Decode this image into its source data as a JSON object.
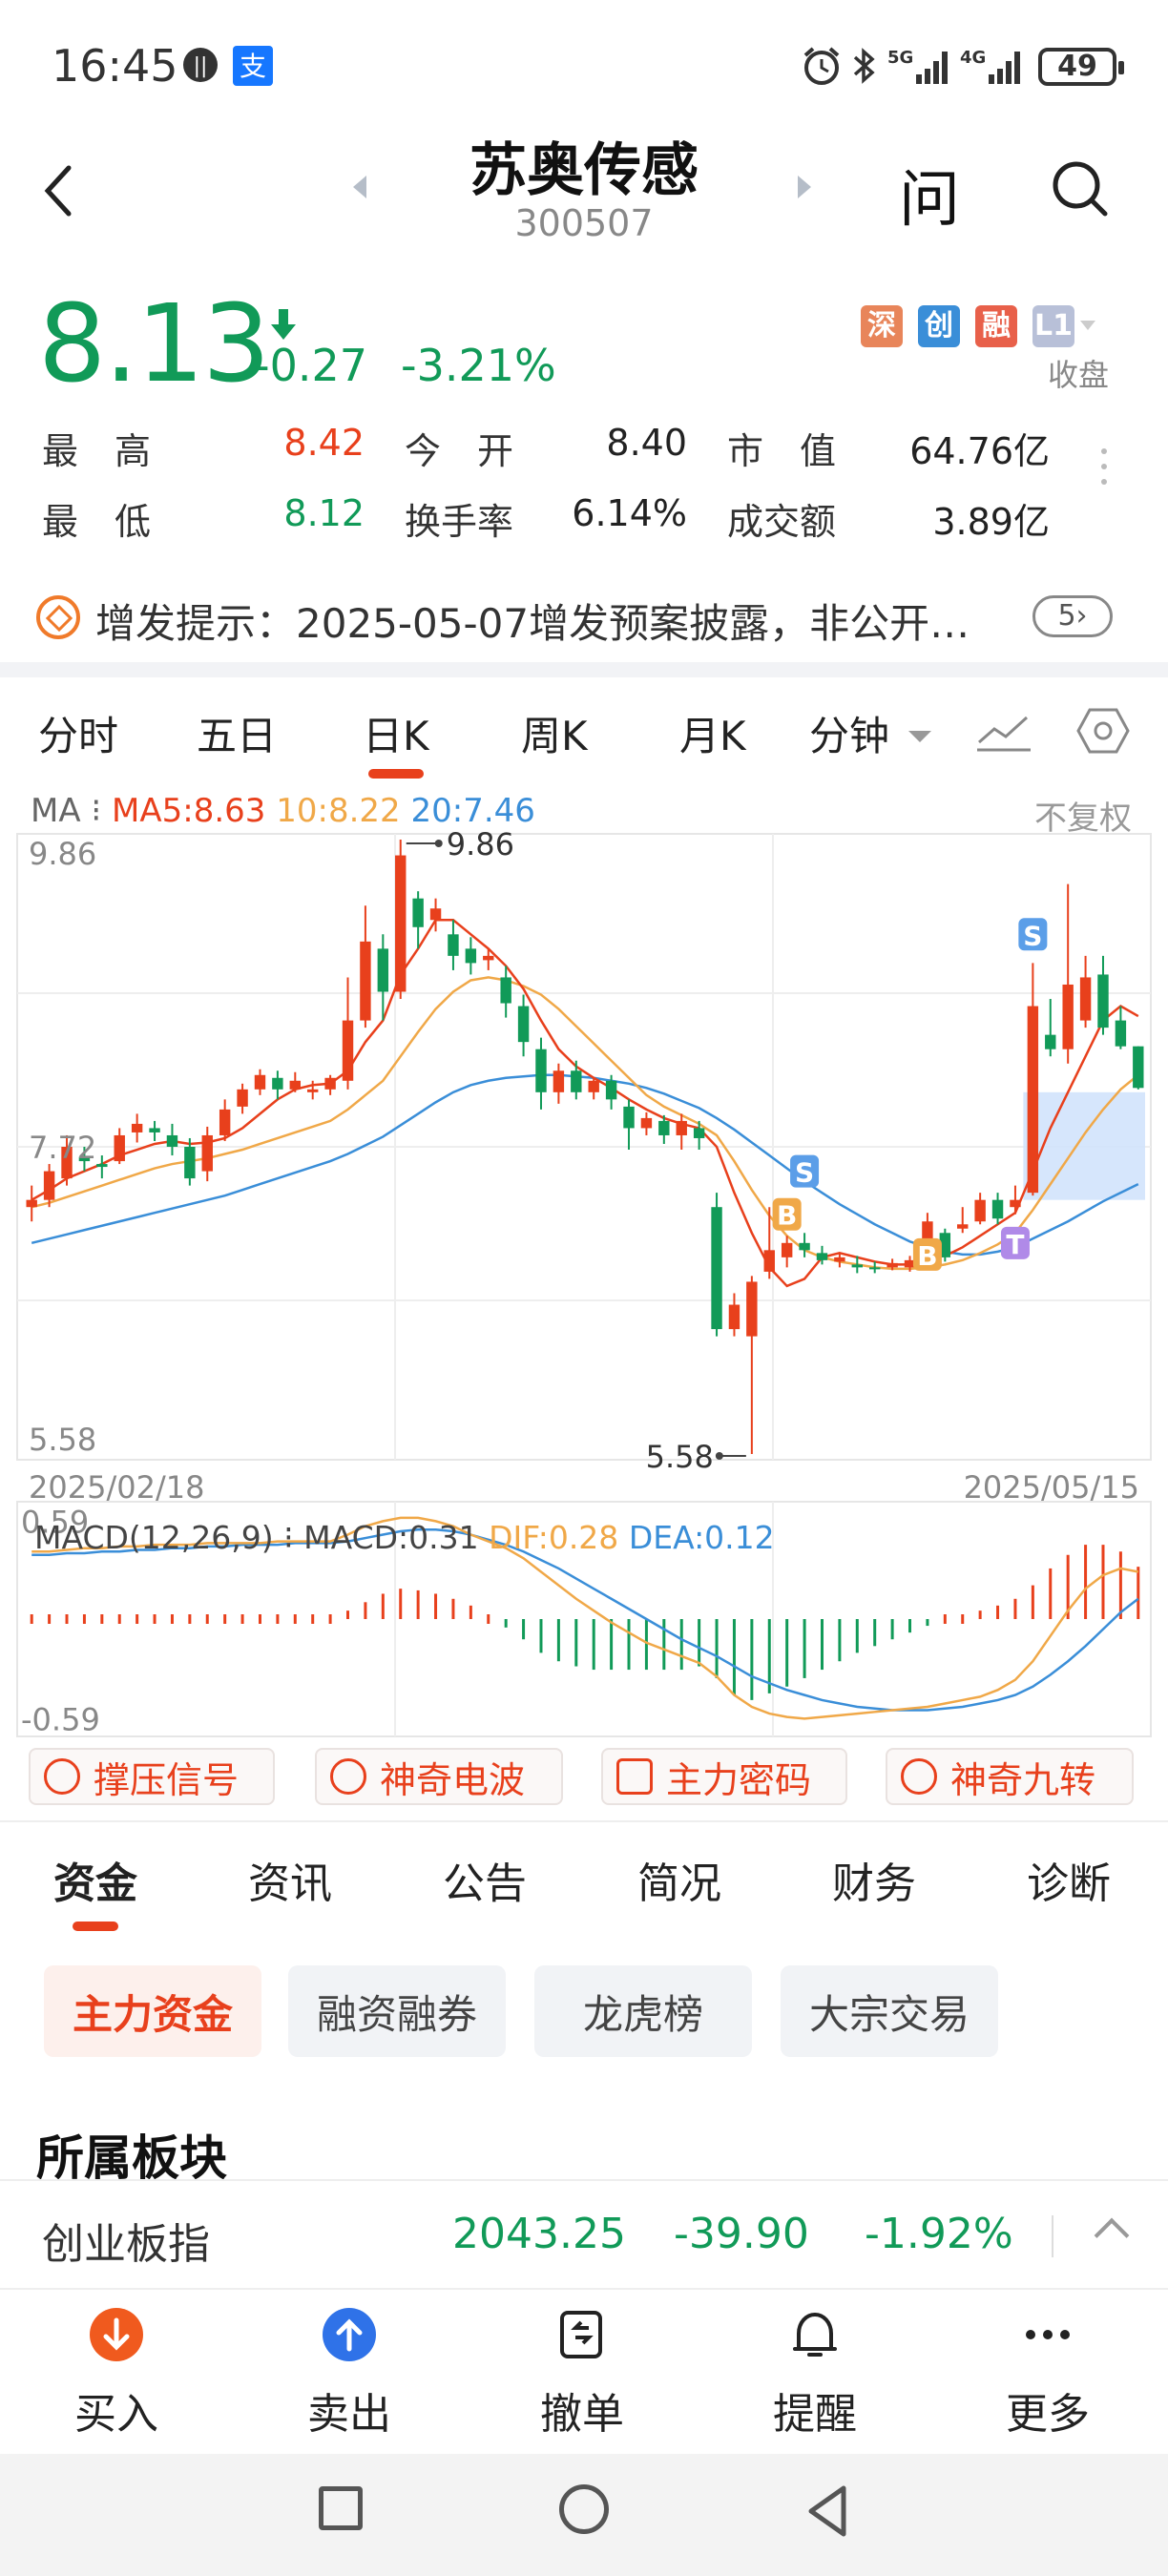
{
  "status_bar": {
    "time": "16:45",
    "battery": "49",
    "network_1": "5G",
    "network_2": "4G"
  },
  "header": {
    "stock_name": "苏奥传感",
    "stock_code": "300507",
    "ask_label": "问"
  },
  "quote": {
    "price": "8.13",
    "change": "-0.27",
    "change_pct": "-3.21%",
    "badges": [
      "深",
      "创",
      "融",
      "L1"
    ],
    "market_status": "收盘",
    "rows": [
      [
        {
          "label": "最　高",
          "value": "8.42",
          "tone": "red"
        },
        {
          "label": "今　开",
          "value": "8.40",
          "tone": "neutral"
        },
        {
          "label": "市　值",
          "value": "64.76亿",
          "tone": "neutral"
        }
      ],
      [
        {
          "label": "最　低",
          "value": "8.12",
          "tone": "green"
        },
        {
          "label": "换手率",
          "value": "6.14%",
          "tone": "neutral"
        },
        {
          "label": "成交额",
          "value": "3.89亿",
          "tone": "neutral"
        }
      ]
    ]
  },
  "notice": {
    "text": "增发提示：2025-05-07增发预案披露，非公开…",
    "count": "5"
  },
  "chart_tabs": [
    "分时",
    "五日",
    "日K",
    "周K",
    "月K",
    "分钟"
  ],
  "active_chart_tab": "日K",
  "ma": {
    "prefix": "MA",
    "ma5": "MA5:8.63",
    "ma10": "10:8.22",
    "ma20": "20:7.46",
    "adjust": "不复权"
  },
  "colors": {
    "up": "#e8401c",
    "down": "#119a58",
    "ma5": "#e8401c",
    "ma10": "#f0a848",
    "ma20": "#3a8ed8",
    "badge_shen": "#e8855a",
    "badge_chuang": "#3a8ed8",
    "badge_rong": "#e8604a",
    "badge_l1": "#b8c0d8"
  },
  "chart_data": {
    "type": "candlestick",
    "y_top": "9.86",
    "y_mid": "7.72",
    "y_bottom": "5.58",
    "ylim": [
      5.58,
      9.86
    ],
    "start_date": "2025/02/18",
    "end_date": "2025/05/15",
    "high_annotation": "9.86",
    "low_annotation": "5.58",
    "candles": [
      [
        7.3,
        7.35,
        7.2,
        7.45
      ],
      [
        7.35,
        7.55,
        7.3,
        7.6
      ],
      [
        7.5,
        7.72,
        7.45,
        7.8
      ],
      [
        7.65,
        7.62,
        7.55,
        7.72
      ],
      [
        7.6,
        7.58,
        7.5,
        7.66
      ],
      [
        7.62,
        7.8,
        7.6,
        7.85
      ],
      [
        7.82,
        7.88,
        7.75,
        7.95
      ],
      [
        7.85,
        7.82,
        7.76,
        7.9
      ],
      [
        7.8,
        7.72,
        7.66,
        7.88
      ],
      [
        7.72,
        7.5,
        7.45,
        7.78
      ],
      [
        7.55,
        7.8,
        7.48,
        7.86
      ],
      [
        7.8,
        7.98,
        7.76,
        8.05
      ],
      [
        8.0,
        8.12,
        7.95,
        8.16
      ],
      [
        8.12,
        8.22,
        8.08,
        8.26
      ],
      [
        8.2,
        8.12,
        8.05,
        8.25
      ],
      [
        8.12,
        8.18,
        8.1,
        8.24
      ],
      [
        8.1,
        8.12,
        8.05,
        8.18
      ],
      [
        8.12,
        8.2,
        8.08,
        8.22
      ],
      [
        8.18,
        8.6,
        8.12,
        8.9
      ],
      [
        8.6,
        9.15,
        8.55,
        9.4
      ],
      [
        9.1,
        8.8,
        8.6,
        9.2
      ],
      [
        8.8,
        9.75,
        8.75,
        9.86
      ],
      [
        9.45,
        9.25,
        9.1,
        9.5
      ],
      [
        9.3,
        9.38,
        9.22,
        9.45
      ],
      [
        9.2,
        9.05,
        8.95,
        9.3
      ],
      [
        9.1,
        9.0,
        8.92,
        9.18
      ],
      [
        9.02,
        9.05,
        8.95,
        9.1
      ],
      [
        8.9,
        8.72,
        8.62,
        8.98
      ],
      [
        8.7,
        8.45,
        8.35,
        8.78
      ],
      [
        8.4,
        8.1,
        7.98,
        8.48
      ],
      [
        8.1,
        8.25,
        8.02,
        8.3
      ],
      [
        8.25,
        8.1,
        8.05,
        8.32
      ],
      [
        8.1,
        8.18,
        8.05,
        8.2
      ],
      [
        8.18,
        8.05,
        7.98,
        8.22
      ],
      [
        8.0,
        7.85,
        7.7,
        8.05
      ],
      [
        7.85,
        7.92,
        7.8,
        7.96
      ],
      [
        7.9,
        7.8,
        7.74,
        7.94
      ],
      [
        7.8,
        7.9,
        7.7,
        7.95
      ],
      [
        7.85,
        7.78,
        7.7,
        7.9
      ],
      [
        7.3,
        6.45,
        6.4,
        7.4
      ],
      [
        6.45,
        6.62,
        6.4,
        6.7
      ],
      [
        6.4,
        6.78,
        5.58,
        6.82
      ],
      [
        6.85,
        7.0,
        6.8,
        7.3
      ],
      [
        6.95,
        7.05,
        6.88,
        7.1
      ],
      [
        7.05,
        7.0,
        6.95,
        7.12
      ],
      [
        6.98,
        6.93,
        6.9,
        7.03
      ],
      [
        6.92,
        6.95,
        6.88,
        6.98
      ],
      [
        6.9,
        6.88,
        6.84,
        6.96
      ],
      [
        6.88,
        6.87,
        6.84,
        6.92
      ],
      [
        6.88,
        6.91,
        6.86,
        6.94
      ],
      [
        6.88,
        6.93,
        6.85,
        6.96
      ],
      [
        6.94,
        7.2,
        6.9,
        7.26
      ],
      [
        7.12,
        6.95,
        6.92,
        7.15
      ],
      [
        7.15,
        7.18,
        7.12,
        7.3
      ],
      [
        7.2,
        7.35,
        7.18,
        7.4
      ],
      [
        7.35,
        7.22,
        7.18,
        7.4
      ],
      [
        7.3,
        7.35,
        7.25,
        7.45
      ],
      [
        7.4,
        8.7,
        7.38,
        9.0
      ],
      [
        8.5,
        8.4,
        8.35,
        8.75
      ],
      [
        8.4,
        8.85,
        8.3,
        9.55
      ],
      [
        8.6,
        8.9,
        8.55,
        9.05
      ],
      [
        8.92,
        8.55,
        8.5,
        9.05
      ],
      [
        8.6,
        8.42,
        8.4,
        8.7
      ],
      [
        8.42,
        8.13,
        8.12,
        8.42
      ]
    ],
    "ma5": [
      7.35,
      7.42,
      7.5,
      7.55,
      7.6,
      7.66,
      7.7,
      7.74,
      7.76,
      7.74,
      7.75,
      7.78,
      7.85,
      7.95,
      8.05,
      8.12,
      8.15,
      8.16,
      8.25,
      8.45,
      8.6,
      8.92,
      9.1,
      9.3,
      9.3,
      9.2,
      9.1,
      8.98,
      8.82,
      8.6,
      8.4,
      8.28,
      8.2,
      8.13,
      8.05,
      7.98,
      7.92,
      7.88,
      7.85,
      7.72,
      7.4,
      7.12,
      6.88,
      6.75,
      6.8,
      6.95,
      6.98,
      6.95,
      6.92,
      6.9,
      6.9,
      6.95,
      6.96,
      7.02,
      7.1,
      7.18,
      7.26,
      7.55,
      7.85,
      8.1,
      8.35,
      8.6,
      8.7,
      8.63
    ],
    "ma10": [
      7.3,
      7.33,
      7.37,
      7.41,
      7.45,
      7.49,
      7.53,
      7.57,
      7.6,
      7.62,
      7.64,
      7.67,
      7.7,
      7.74,
      7.78,
      7.82,
      7.86,
      7.9,
      7.98,
      8.08,
      8.18,
      8.35,
      8.52,
      8.68,
      8.8,
      8.88,
      8.9,
      8.88,
      8.84,
      8.78,
      8.68,
      8.56,
      8.44,
      8.32,
      8.2,
      8.08,
      8.0,
      7.94,
      7.88,
      7.8,
      7.62,
      7.42,
      7.24,
      7.1,
      7.0,
      6.95,
      6.92,
      6.9,
      6.88,
      6.87,
      6.87,
      6.88,
      6.9,
      6.93,
      6.98,
      7.04,
      7.12,
      7.28,
      7.46,
      7.64,
      7.82,
      7.98,
      8.12,
      8.22
    ],
    "ma20": [
      7.05,
      7.08,
      7.11,
      7.14,
      7.17,
      7.2,
      7.23,
      7.26,
      7.29,
      7.32,
      7.35,
      7.38,
      7.42,
      7.46,
      7.5,
      7.54,
      7.58,
      7.62,
      7.67,
      7.73,
      7.79,
      7.87,
      7.95,
      8.03,
      8.1,
      8.15,
      8.18,
      8.2,
      8.21,
      8.22,
      8.22,
      8.21,
      8.2,
      8.18,
      8.16,
      8.13,
      8.09,
      8.04,
      7.99,
      7.92,
      7.84,
      7.75,
      7.66,
      7.57,
      7.48,
      7.4,
      7.32,
      7.25,
      7.18,
      7.12,
      7.06,
      7.02,
      6.99,
      6.97,
      6.97,
      6.99,
      7.02,
      7.08,
      7.14,
      7.2,
      7.27,
      7.34,
      7.4,
      7.46
    ]
  },
  "macd": {
    "title_prefix": "MACD(12,26,9)",
    "macd": "MACD:0.31",
    "dif": "DIF:0.28",
    "dea": "DEA:0.12",
    "y_top": "0.59",
    "y_bottom": "-0.59",
    "hist": [
      0.03,
      0.03,
      0.03,
      0.03,
      0.03,
      0.03,
      0.03,
      0.03,
      0.03,
      0.02,
      0.02,
      0.02,
      0.02,
      0.02,
      0.02,
      0.02,
      0.02,
      0.02,
      0.05,
      0.1,
      0.15,
      0.18,
      0.17,
      0.15,
      0.12,
      0.08,
      0.02,
      -0.05,
      -0.12,
      -0.2,
      -0.25,
      -0.28,
      -0.3,
      -0.3,
      -0.3,
      -0.3,
      -0.3,
      -0.3,
      -0.28,
      -0.35,
      -0.45,
      -0.48,
      -0.44,
      -0.4,
      -0.35,
      -0.3,
      -0.25,
      -0.2,
      -0.16,
      -0.12,
      -0.08,
      -0.04,
      0.0,
      0.02,
      0.05,
      0.08,
      0.12,
      0.2,
      0.3,
      0.38,
      0.44,
      0.44,
      0.4,
      0.31
    ],
    "dif_line": [
      0.4,
      0.4,
      0.41,
      0.42,
      0.42,
      0.43,
      0.43,
      0.44,
      0.44,
      0.44,
      0.45,
      0.45,
      0.45,
      0.45,
      0.46,
      0.46,
      0.46,
      0.46,
      0.5,
      0.55,
      0.58,
      0.6,
      0.6,
      0.58,
      0.55,
      0.5,
      0.46,
      0.42,
      0.36,
      0.28,
      0.2,
      0.12,
      0.05,
      -0.02,
      -0.08,
      -0.14,
      -0.18,
      -0.22,
      -0.26,
      -0.34,
      -0.45,
      -0.52,
      -0.56,
      -0.58,
      -0.59,
      -0.58,
      -0.57,
      -0.56,
      -0.55,
      -0.54,
      -0.53,
      -0.52,
      -0.5,
      -0.48,
      -0.46,
      -0.42,
      -0.36,
      -0.25,
      -0.1,
      0.05,
      0.18,
      0.26,
      0.3,
      0.28
    ],
    "dea_line": [
      0.38,
      0.38,
      0.39,
      0.39,
      0.4,
      0.4,
      0.41,
      0.41,
      0.42,
      0.42,
      0.43,
      0.43,
      0.44,
      0.44,
      0.44,
      0.45,
      0.45,
      0.45,
      0.46,
      0.48,
      0.5,
      0.52,
      0.53,
      0.53,
      0.52,
      0.5,
      0.47,
      0.44,
      0.4,
      0.35,
      0.3,
      0.24,
      0.18,
      0.12,
      0.06,
      0.0,
      -0.06,
      -0.12,
      -0.17,
      -0.22,
      -0.28,
      -0.34,
      -0.38,
      -0.42,
      -0.45,
      -0.48,
      -0.5,
      -0.52,
      -0.53,
      -0.54,
      -0.54,
      -0.54,
      -0.53,
      -0.52,
      -0.5,
      -0.48,
      -0.45,
      -0.4,
      -0.33,
      -0.25,
      -0.16,
      -0.06,
      0.04,
      0.12
    ]
  },
  "markers": {
    "b_label": "B",
    "s_label": "S",
    "t_label": "T"
  },
  "signals": [
    "撑压信号",
    "神奇电波",
    "主力密码",
    "神奇九转"
  ],
  "info_tabs": [
    "资金",
    "资讯",
    "公告",
    "简况",
    "财务",
    "诊断"
  ],
  "chips": [
    "主力资金",
    "融资融券",
    "龙虎榜",
    "大宗交易"
  ],
  "sector": {
    "title": "所属板块",
    "name": "创业板指",
    "value": "2043.25",
    "change": "-39.90",
    "change_pct": "-1.92%"
  },
  "actions": [
    "买入",
    "卖出",
    "撤单",
    "提醒",
    "更多"
  ]
}
